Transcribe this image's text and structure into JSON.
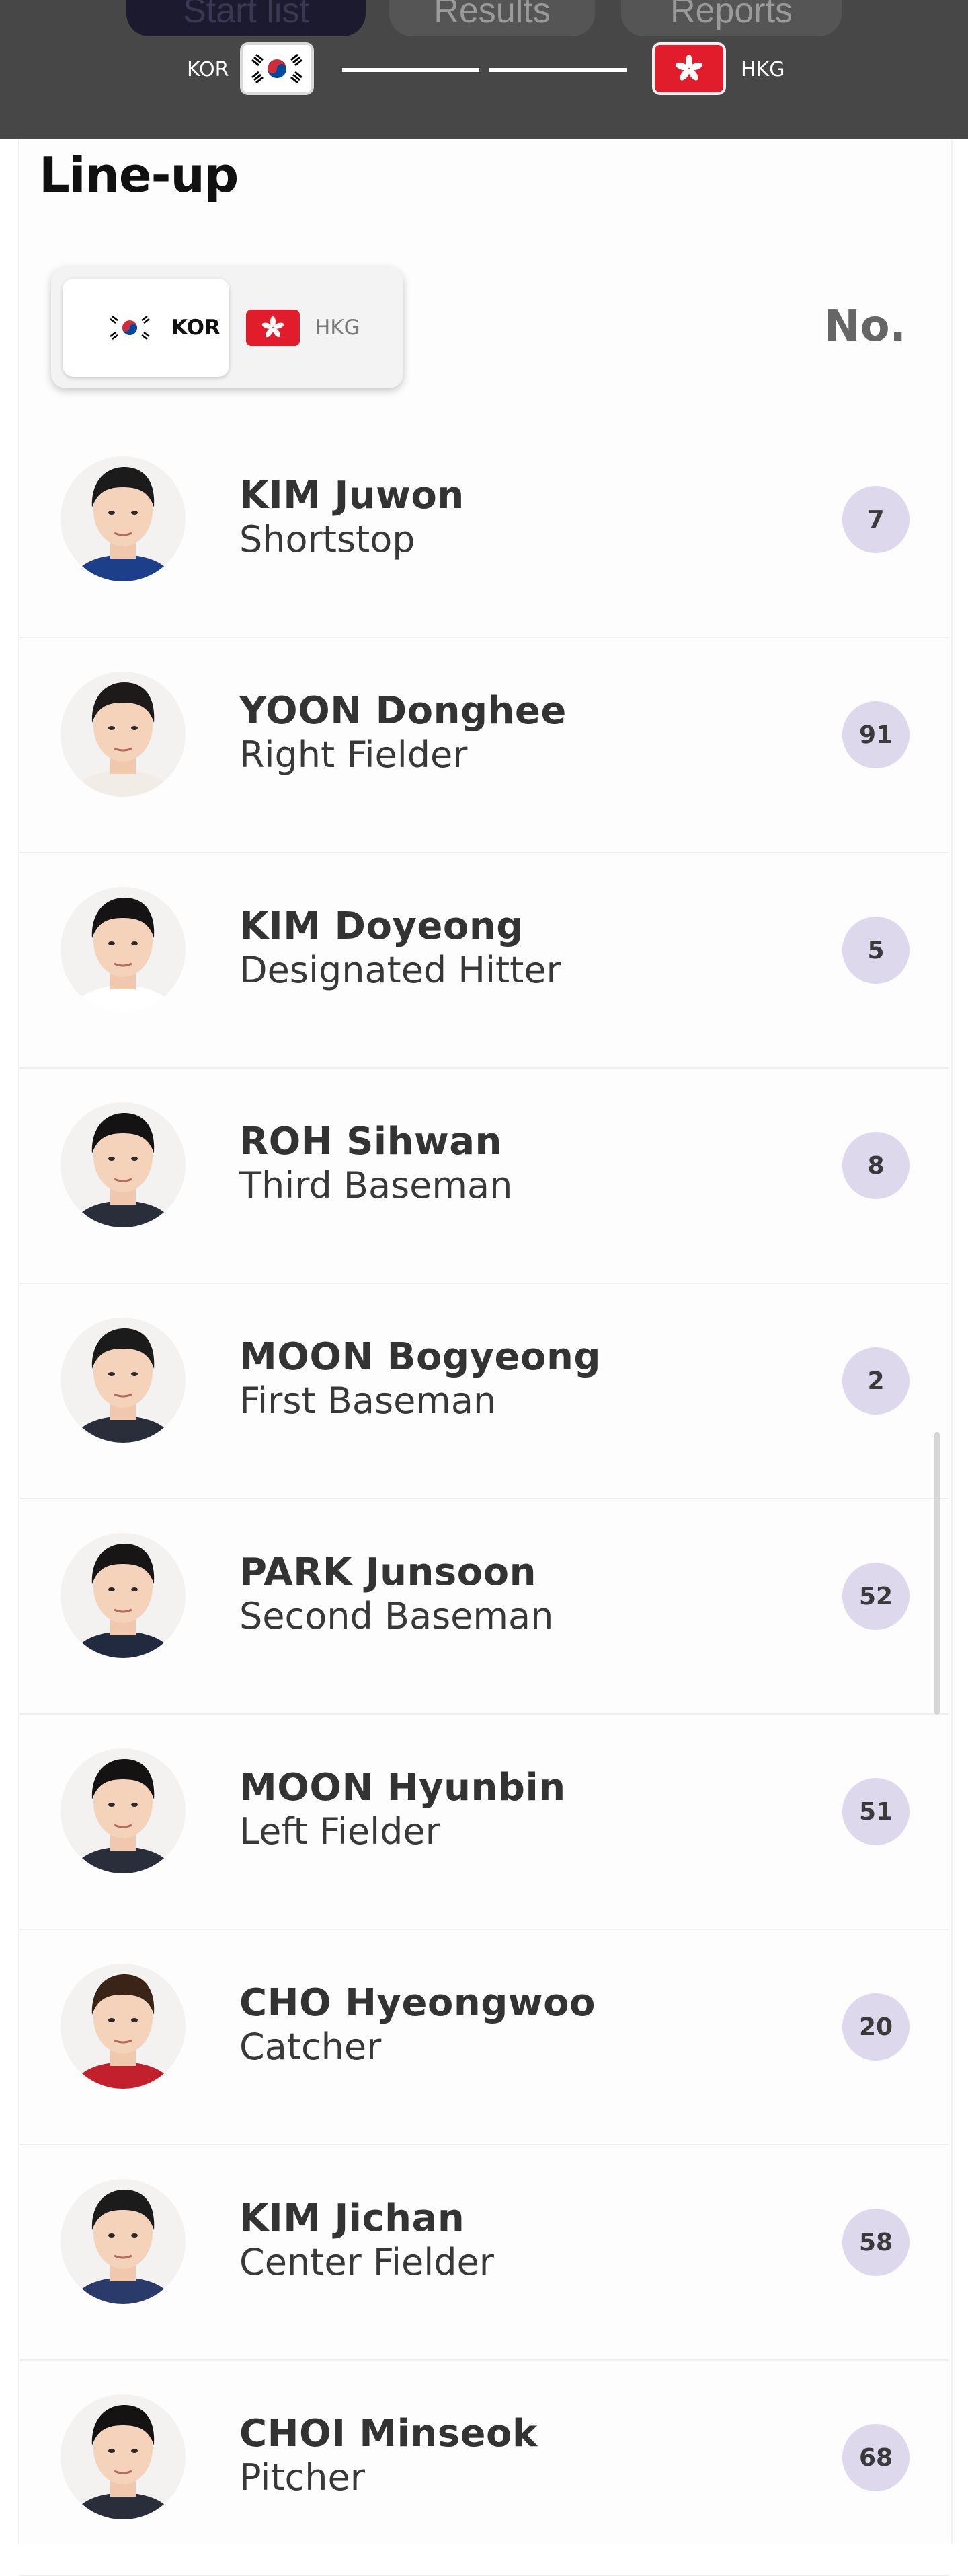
{
  "tabs": [
    {
      "label": "Start list",
      "active": true
    },
    {
      "label": "Results",
      "active": false
    },
    {
      "label": "Reports",
      "active": false
    }
  ],
  "match": {
    "home_code": "KOR",
    "away_code": "HKG"
  },
  "lineup": {
    "title": "Line-up",
    "toggle": {
      "home_label": "KOR",
      "away_label": "HKG",
      "selected": "KOR"
    },
    "number_header": "No.",
    "players": [
      {
        "name": "KIM Juwon",
        "position": "Shortstop",
        "number": "7",
        "jersey": "#1d3f8a",
        "hair": "#1b1b1b"
      },
      {
        "name": "YOON Donghee",
        "position": "Right Fielder",
        "number": "91",
        "jersey": "#f1ece6",
        "hair": "#1d1a19"
      },
      {
        "name": "KIM Doyeong",
        "position": "Designated Hitter",
        "number": "5",
        "jersey": "#ffffff",
        "hair": "#151313"
      },
      {
        "name": "ROH Sihwan",
        "position": "Third Baseman",
        "number": "8",
        "jersey": "#2a2d3a",
        "hair": "#141212"
      },
      {
        "name": "MOON Bogyeong",
        "position": "First Baseman",
        "number": "2",
        "jersey": "#2a2d3a",
        "hair": "#1b1b1b"
      },
      {
        "name": "PARK Junsoon",
        "position": "Second Baseman",
        "number": "52",
        "jersey": "#222a3f",
        "hair": "#171515"
      },
      {
        "name": "MOON Hyunbin",
        "position": "Left Fielder",
        "number": "51",
        "jersey": "#2a2d3a",
        "hair": "#141212"
      },
      {
        "name": "CHO Hyeongwoo",
        "position": "Catcher",
        "number": "20",
        "jersey": "#c2202c",
        "hair": "#3a2418"
      },
      {
        "name": "KIM Jichan",
        "position": "Center Fielder",
        "number": "58",
        "jersey": "#2a3a6a",
        "hair": "#1b1b1b"
      },
      {
        "name": "CHOI Minseok",
        "position": "Pitcher",
        "number": "68",
        "jersey": "#2a2d3a",
        "hair": "#141212"
      }
    ]
  },
  "colors": {
    "header_bg": "#474747",
    "number_badge": "#ddd8ec",
    "hkg_red": "#e21d2b"
  }
}
